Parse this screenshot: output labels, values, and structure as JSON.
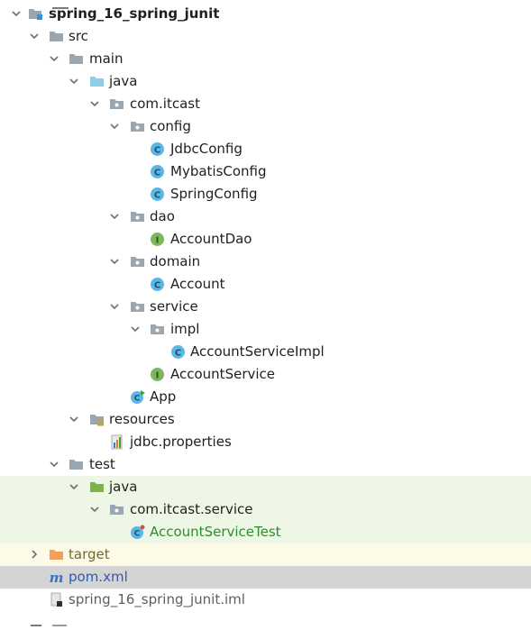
{
  "colors": {
    "folder": "#9aa7b0",
    "source_folder": "#8fcde8",
    "test_folder": "#7fb24a",
    "excluded_folder": "#f0a05a",
    "class_icon": "#5ab8e6",
    "interface_icon": "#7cb85a",
    "test_row_bg": "#eef7e6",
    "target_row_bg": "#fdfbe8",
    "selected_row_bg": "#d4d4d4"
  },
  "tree": {
    "project": {
      "label": "spring_16_spring_junit",
      "icon": "project-module-icon"
    },
    "src": {
      "label": "src",
      "icon": "folder-icon"
    },
    "main": {
      "label": "main",
      "icon": "folder-icon"
    },
    "main_java": {
      "label": "java",
      "icon": "source-folder-icon"
    },
    "pkg_comitcast": {
      "label": "com.itcast",
      "icon": "package-icon"
    },
    "pkg_config": {
      "label": "config",
      "icon": "package-icon"
    },
    "jdbc_config": {
      "label": "JdbcConfig",
      "icon": "class-icon"
    },
    "mybatis_config": {
      "label": "MybatisConfig",
      "icon": "class-icon"
    },
    "spring_config": {
      "label": "SpringConfig",
      "icon": "class-icon"
    },
    "pkg_dao": {
      "label": "dao",
      "icon": "package-icon"
    },
    "account_dao": {
      "label": "AccountDao",
      "icon": "interface-icon"
    },
    "pkg_domain": {
      "label": "domain",
      "icon": "package-icon"
    },
    "account": {
      "label": "Account",
      "icon": "class-icon"
    },
    "pkg_service": {
      "label": "service",
      "icon": "package-icon"
    },
    "pkg_impl": {
      "label": "impl",
      "icon": "package-icon"
    },
    "account_service_impl": {
      "label": "AccountServiceImpl",
      "icon": "class-icon"
    },
    "account_service": {
      "label": "AccountService",
      "icon": "interface-icon"
    },
    "app": {
      "label": "App",
      "icon": "runnable-class-icon"
    },
    "resources": {
      "label": "resources",
      "icon": "resources-folder-icon"
    },
    "jdbc_properties": {
      "label": "jdbc.properties",
      "icon": "properties-file-icon"
    },
    "test": {
      "label": "test",
      "icon": "folder-icon"
    },
    "test_java": {
      "label": "java",
      "icon": "test-source-folder-icon"
    },
    "pkg_test_service": {
      "label": "com.itcast.service",
      "icon": "package-icon"
    },
    "account_service_test": {
      "label": "AccountServiceTest",
      "icon": "test-class-icon"
    },
    "target": {
      "label": "target",
      "icon": "excluded-folder-icon"
    },
    "pom": {
      "label": "pom.xml",
      "icon": "maven-icon"
    },
    "iml": {
      "label": "spring_16_spring_junit.iml",
      "icon": "iml-file-icon"
    }
  }
}
